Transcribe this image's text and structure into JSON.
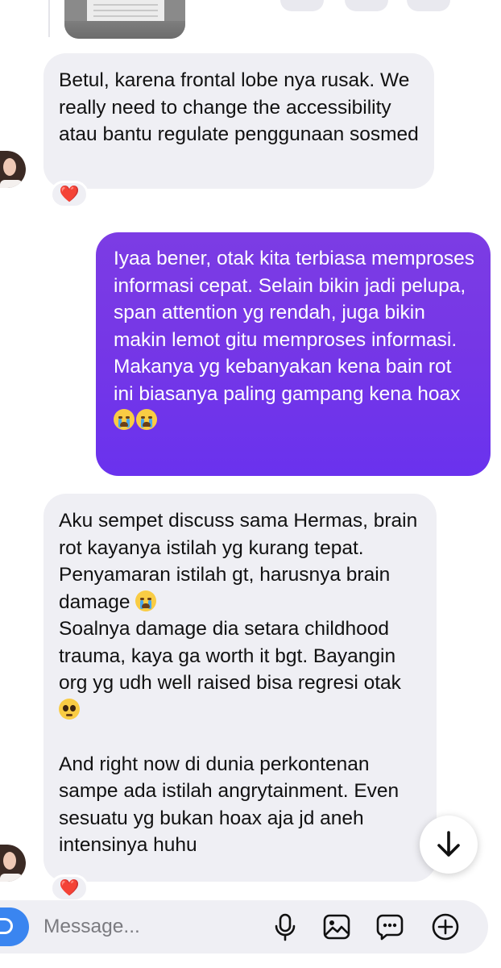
{
  "messages": [
    {
      "direction": "incoming",
      "text": "Betul, karena frontal lobe nya rusak. We really need to change the accessibility atau bantu regulate penggunaan sosmed",
      "reaction": "❤️"
    },
    {
      "direction": "outgoing",
      "text": "Iyaa bener, otak kita terbiasa memproses informasi cepat. Selain bikin jadi pelupa, span attention yg rendah, juga bikin makin lemot gitu memproses informasi. Makanya yg kebanyakan kena bain rot ini biasanya paling gampang kena hoax",
      "emoji": [
        "loudly-crying-face",
        "loudly-crying-face"
      ]
    },
    {
      "direction": "incoming",
      "paragraph_1": "Aku sempet discuss sama Hermas, brain rot kayanya istilah yg kurang tepat. Penyamaran istilah gt, harusnya brain damage",
      "paragraph_1_emoji": "loudly-crying-face",
      "paragraph_2": "Soalnya damage dia setara childhood trauma, kaya ga worth it bgt. Bayangin org yg udh well raised bisa regresi otak",
      "paragraph_2_emoji": "pleading-face",
      "paragraph_3": "And right now di dunia perkontenan sampe ada istilah angrytainment. Even sesuatu yg bukan hoax aja jd aneh intensinya huhu",
      "reaction": "❤️"
    }
  ],
  "composer": {
    "placeholder": "Message...",
    "icons": [
      "camera-icon",
      "microphone-icon",
      "gallery-icon",
      "chat-bubble-icon",
      "add-icon"
    ]
  },
  "scroll_button_icon": "arrow-down-icon",
  "colors": {
    "incoming_bubble": "#efeff4",
    "outgoing_gradient_start": "#7c3ce4",
    "outgoing_gradient_end": "#6a32ee",
    "reaction_heart": "#e0182c",
    "camera_button": "#3a85f0"
  }
}
